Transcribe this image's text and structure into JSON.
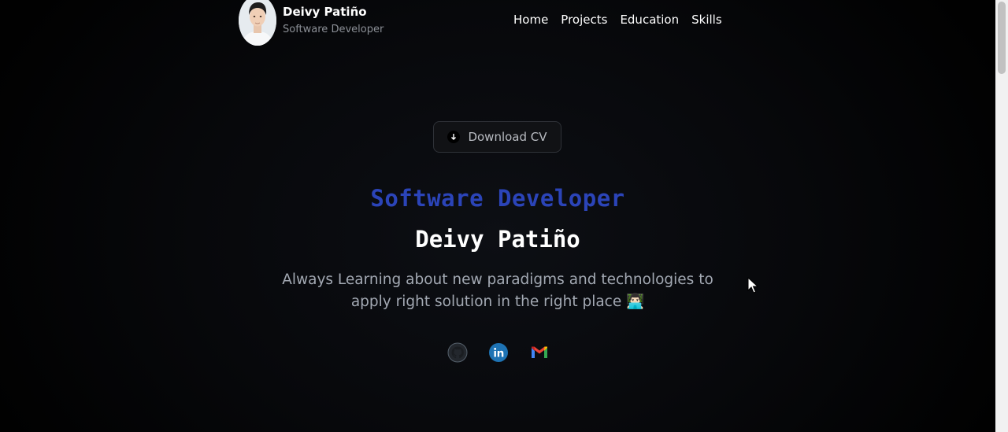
{
  "header": {
    "avatar_icon": "profile-photo",
    "name": "Deivy Patiño",
    "role": "Software Developer",
    "nav": [
      {
        "label": "Home"
      },
      {
        "label": "Projects"
      },
      {
        "label": "Education"
      },
      {
        "label": "Skills"
      }
    ]
  },
  "hero": {
    "cv_button": {
      "label": "Download CV",
      "icon": "download-arrow-icon"
    },
    "role": "Software Developer",
    "name": "Deivy Patiño",
    "tagline": "Always Learning about new paradigms and technologies to apply right solution in the right place 👨🏻‍💻",
    "social": [
      {
        "icon": "github-icon"
      },
      {
        "icon": "linkedin-icon"
      },
      {
        "icon": "gmail-icon"
      }
    ]
  },
  "colors": {
    "background": "#07080b",
    "accent_blue": "#2b44b8",
    "text_primary": "#ffffff",
    "text_muted": "#a3a9b3"
  }
}
